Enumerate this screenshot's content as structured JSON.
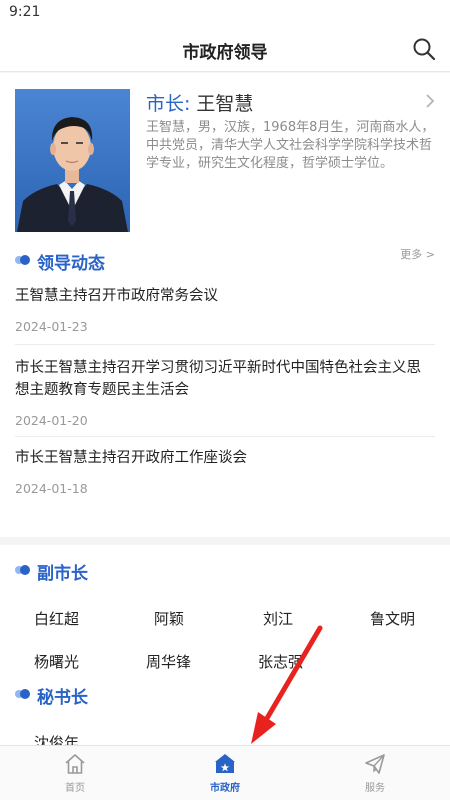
{
  "status": {
    "time": "9:21"
  },
  "header": {
    "title": "市政府领导"
  },
  "mayor": {
    "role": "市长:",
    "name": "王智慧",
    "desc": "王智慧，男，汉族，1968年8月生，河南商水人，中共党员，清华大学人文社会科学学院科学技术哲学专业，研究生文化程度，哲学硕士学位。"
  },
  "news_section": {
    "title": "领导动态",
    "more": "更多 >"
  },
  "news": [
    {
      "title": "王智慧主持召开市政府常务会议",
      "date": "2024-01-23"
    },
    {
      "title": "市长王智慧主持召开学习贯彻习近平新时代中国特色社会主义思想主题教育专题民主生活会",
      "date": "2024-01-20"
    },
    {
      "title": "市长王智慧主持召开政府工作座谈会",
      "date": "2024-01-18"
    }
  ],
  "vice_mayors": {
    "title": "副市长",
    "names": [
      "白红超",
      "阿颖",
      "刘江",
      "鲁文明",
      "杨曙光",
      "周华锋",
      "张志强"
    ]
  },
  "secretary": {
    "title": "秘书长",
    "names": [
      "沈俊年"
    ]
  },
  "tabbar": {
    "items": [
      {
        "label": "首页",
        "icon": "home-icon",
        "active": false
      },
      {
        "label": "市政府",
        "icon": "government-icon",
        "active": true
      },
      {
        "label": "服务",
        "icon": "paper-plane-icon",
        "active": false
      }
    ]
  },
  "colors": {
    "accent": "#2a63c7",
    "annotation": "#e8231f"
  }
}
